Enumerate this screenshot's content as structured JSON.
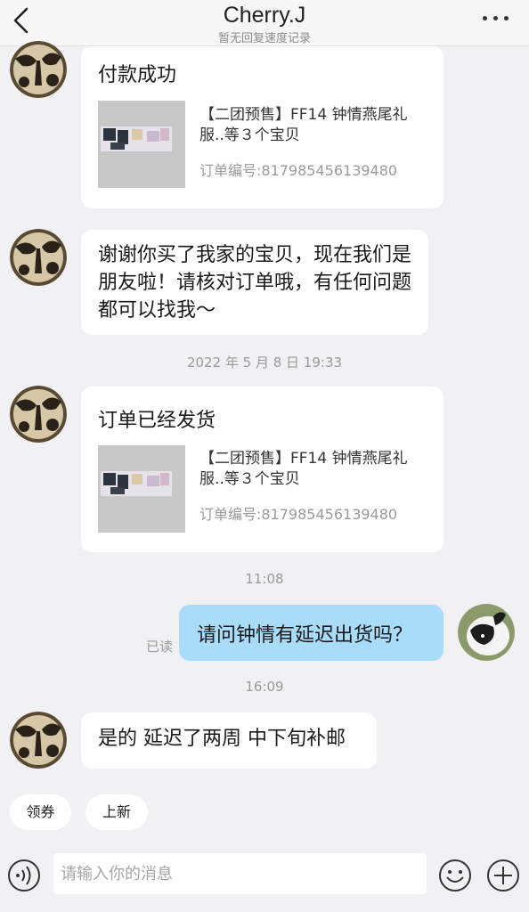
{
  "header": {
    "title": "Cherry.J",
    "subtitle": "暂无回复速度记录",
    "back_icon": "chevron-left-icon",
    "more_icon": "more-dots-icon"
  },
  "messages": [
    {
      "type": "order_card",
      "title": "付款成功",
      "product": "【二团预售】FF14 钟情燕尾礼服..等３个宝贝",
      "order_no": "订单编号:817985456139480"
    },
    {
      "type": "text",
      "text": "谢谢你买了我家的宝贝，现在我们是朋友啦！请核对订单哦，有任何问题都可以找我～"
    },
    {
      "type": "order_card",
      "title": "订单已经发货",
      "product": "【二团预售】FF14 钟情燕尾礼服..等３个宝贝",
      "order_no": "订单编号:817985456139480"
    },
    {
      "type": "text_self",
      "text": "请问钟情有延迟出货吗？",
      "read": "已读"
    },
    {
      "type": "text",
      "text": "是的 延迟了两周 中下旬补邮"
    }
  ],
  "timestamps": [
    "2022 年 5 月 8 日 19:33",
    "11:08",
    "16:09"
  ],
  "chips": [
    "领券",
    "上新"
  ],
  "input": {
    "placeholder": "请输入你的消息",
    "value": ""
  },
  "icons": {
    "voice": "voice-icon",
    "emoji": "emoji-icon",
    "plus": "plus-icon"
  },
  "colors": {
    "self_bubble": "#a9dcfa",
    "background": "#f1f1f3"
  }
}
